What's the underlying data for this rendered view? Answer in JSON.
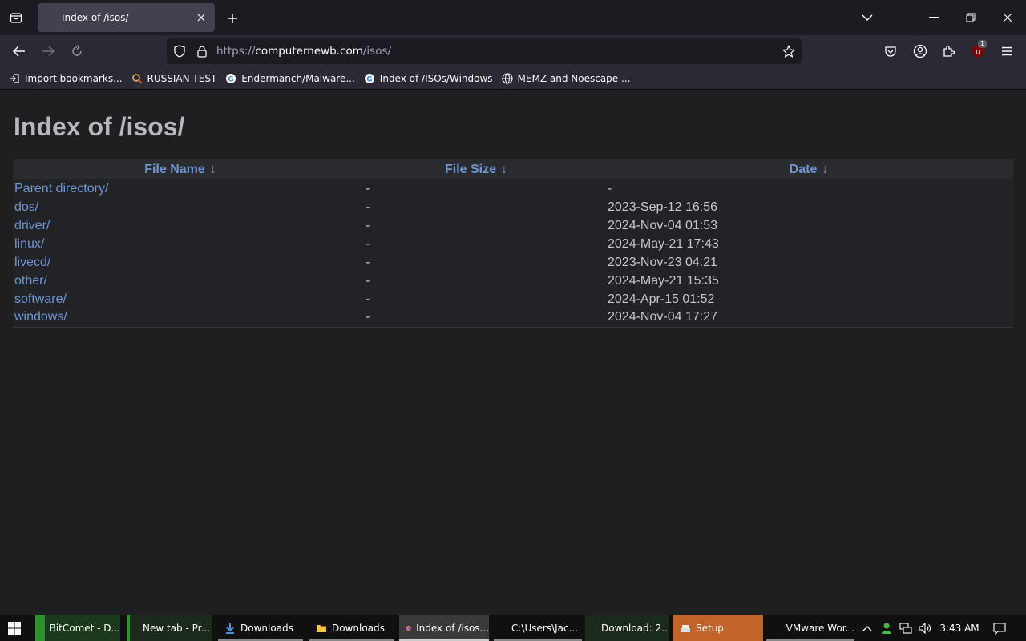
{
  "browser": {
    "tab": {
      "title": "Index of /isos/"
    },
    "url": {
      "prefix": "https://",
      "domain": "computernewb.com",
      "path": "/isos/"
    },
    "bookmarks": [
      {
        "label": "Import bookmarks...",
        "icon": "import-icon"
      },
      {
        "label": "RUSSIAN TEST",
        "icon": "magnifier-favicon"
      },
      {
        "label": "Endermanch/Malware...",
        "icon": "google-favicon"
      },
      {
        "label": "Index of /ISOs/Windows",
        "icon": "google-favicon"
      },
      {
        "label": "MEMZ and Noescape ...",
        "icon": "globe-icon"
      }
    ],
    "extension_badge": "1"
  },
  "page": {
    "title": "Index of /isos/",
    "columns": [
      {
        "label": "File Name",
        "arrow": "↓"
      },
      {
        "label": "File Size",
        "arrow": "↓"
      },
      {
        "label": "Date",
        "arrow": "↓"
      }
    ],
    "rows": [
      {
        "name": "Parent directory/",
        "size": "-",
        "date": "-"
      },
      {
        "name": "dos/",
        "size": "-",
        "date": "2023-Sep-12 16:56"
      },
      {
        "name": "driver/",
        "size": "-",
        "date": "2024-Nov-04 01:53"
      },
      {
        "name": "linux/",
        "size": "-",
        "date": "2024-May-21 17:43"
      },
      {
        "name": "livecd/",
        "size": "-",
        "date": "2023-Nov-23 04:21"
      },
      {
        "name": "other/",
        "size": "-",
        "date": "2024-May-21 15:35"
      },
      {
        "name": "software/",
        "size": "-",
        "date": "2024-Apr-15 01:52"
      },
      {
        "name": "windows/",
        "size": "-",
        "date": "2024-Nov-04 17:27"
      }
    ]
  },
  "taskbar": {
    "items": [
      {
        "label": "BitComet - D...",
        "color": "#3a8f3a"
      },
      {
        "label": "New tab - Pr...",
        "color": "#3a8f3a"
      },
      {
        "label": "Downloads",
        "color": ""
      },
      {
        "label": "Downloads",
        "color": ""
      },
      {
        "label": "Index of /isos...",
        "color": "#ff9c00"
      },
      {
        "label": "C:\\Users\\Jac...",
        "color": ""
      },
      {
        "label": "Download: 2...",
        "color": "#3a8f3a"
      },
      {
        "label": "Setup",
        "color": "#c2642a"
      },
      {
        "label": "VMware Wor...",
        "color": ""
      }
    ],
    "clock": "3:43 AM"
  }
}
